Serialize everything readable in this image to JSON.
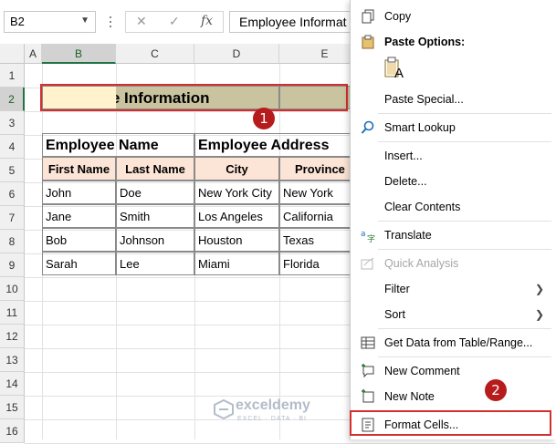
{
  "formula_bar": {
    "name_box": "B2",
    "formula": "Employee Informat",
    "cancel_symbol": "✕",
    "enter_symbol": "✓",
    "fx_symbol": "fx"
  },
  "columns": [
    "A",
    "B",
    "C",
    "D",
    "E"
  ],
  "rows": [
    "1",
    "2",
    "3",
    "4",
    "5",
    "6",
    "7",
    "8",
    "9",
    "10",
    "11",
    "12",
    "13",
    "14",
    "15",
    "16"
  ],
  "sheet": {
    "title": "Employee Information",
    "header_name": "Employee Name",
    "header_address": "Employee Address",
    "subheaders": [
      "First Name",
      "Last Name",
      "City",
      "Province"
    ],
    "data": [
      [
        "John",
        "Doe",
        "New York City",
        "New York"
      ],
      [
        "Jane",
        "Smith",
        "Los Angeles",
        "California"
      ],
      [
        "Bob",
        "Johnson",
        "Houston",
        "Texas"
      ],
      [
        "Sarah",
        "Lee",
        "Miami",
        "Florida"
      ]
    ]
  },
  "badges": [
    "1",
    "2"
  ],
  "context_menu": {
    "copy": "Copy",
    "paste_options": "Paste Options:",
    "paste_icon_letter": "A",
    "paste_special": "Paste Special...",
    "smart_lookup": "Smart Lookup",
    "insert": "Insert...",
    "delete": "Delete...",
    "clear_contents": "Clear Contents",
    "translate": "Translate",
    "quick_analysis": "Quick Analysis",
    "filter": "Filter",
    "sort": "Sort",
    "get_data": "Get Data from Table/Range...",
    "new_comment": "New Comment",
    "new_note": "New Note",
    "format_cells": "Format Cells..."
  },
  "watermark": {
    "name": "exceldemy",
    "tagline": "EXCEL · DATA · BI"
  },
  "colors": {
    "accent": "#217346",
    "highlight_red": "#d32f2f",
    "badge": "#b71c1c",
    "title_fill": "#c9c3a0",
    "subheader_fill": "#fce4d6"
  }
}
